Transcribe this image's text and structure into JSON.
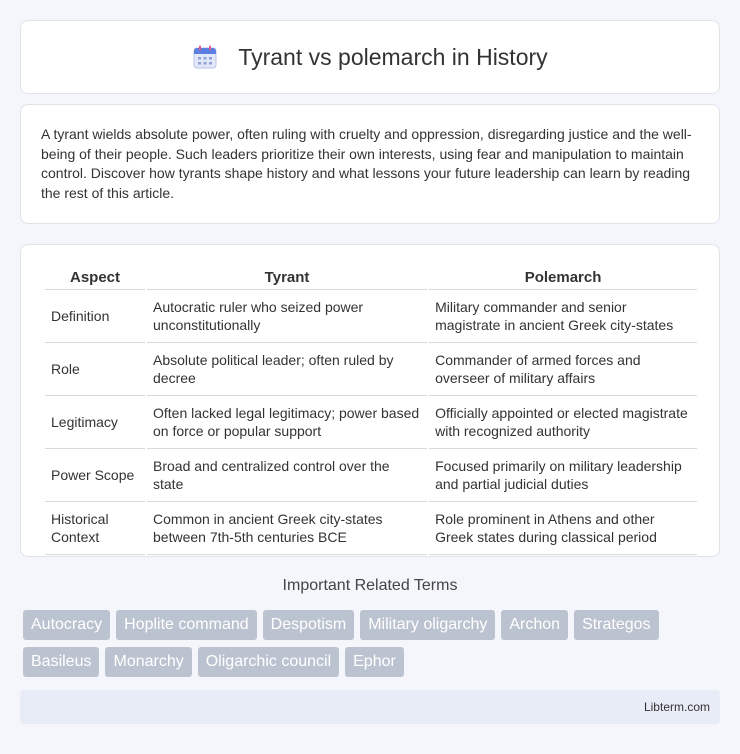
{
  "header": {
    "title": "Tyrant vs polemarch in History",
    "icon": "calendar-icon"
  },
  "intro": {
    "text": "A tyrant wields absolute power, often ruling with cruelty and oppression, disregarding justice and the well-being of their people. Such leaders prioritize their own interests, using fear and manipulation to maintain control. Discover how tyrants shape history and what lessons your future leadership can learn by reading the rest of this article."
  },
  "table": {
    "headers": [
      "Aspect",
      "Tyrant",
      "Polemarch"
    ],
    "rows": [
      [
        "Definition",
        "Autocratic ruler who seized power unconstitutionally",
        "Military commander and senior magistrate in ancient Greek city-states"
      ],
      [
        "Role",
        "Absolute political leader; often ruled by decree",
        "Commander of armed forces and overseer of military affairs"
      ],
      [
        "Legitimacy",
        "Often lacked legal legitimacy; power based on force or popular support",
        "Officially appointed or elected magistrate with recognized authority"
      ],
      [
        "Power Scope",
        "Broad and centralized control over the state",
        "Focused primarily on military leadership and partial judicial duties"
      ],
      [
        "Historical Context",
        "Common in ancient Greek city-states between 7th-5th centuries BCE",
        "Role prominent in Athens and other Greek states during classical period"
      ]
    ]
  },
  "related": {
    "title": "Important Related Terms",
    "tags": [
      "Autocracy",
      "Hoplite command",
      "Despotism",
      "Military oligarchy",
      "Archon",
      "Strategos",
      "Basileus",
      "Monarchy",
      "Oligarchic council",
      "Ephor"
    ]
  },
  "footer": {
    "text": "Libterm.com"
  },
  "colors": {
    "tag_bg": "#bcc3d0",
    "footer_bg": "#e8ecf6",
    "page_bg": "#f4f6fb"
  }
}
